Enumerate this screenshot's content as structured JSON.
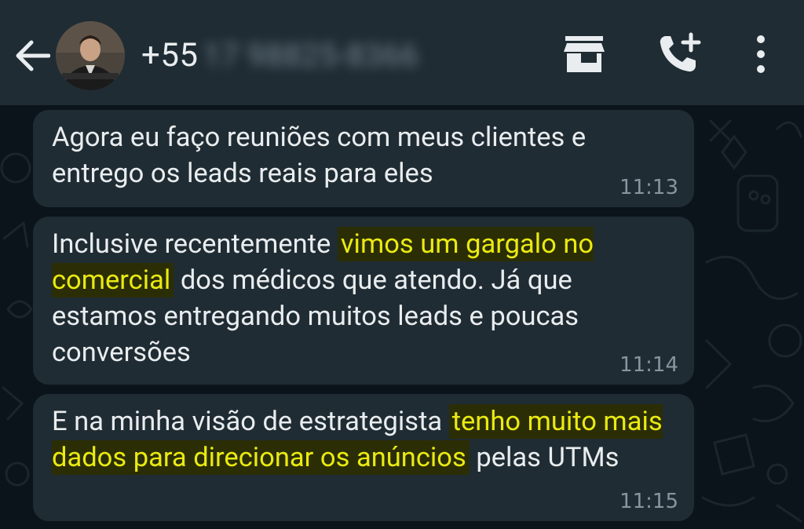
{
  "header": {
    "contact_prefix": "+55",
    "contact_blurred": "17 98825-8366",
    "icons": [
      "back-arrow-icon",
      "avatar",
      "store-icon",
      "call-add-icon",
      "more-vert-icon"
    ]
  },
  "messages": [
    {
      "segments": [
        {
          "text": "Agora eu faço reuniões com meus clientes e entrego os leads reais para eles",
          "highlight": false
        }
      ],
      "time": "11:13"
    },
    {
      "segments": [
        {
          "text": "Inclusive recentemente ",
          "highlight": false
        },
        {
          "text": "vimos um gargalo no comercial",
          "highlight": true
        },
        {
          "text": " dos médicos que atendo. Já que estamos entregando muitos leads e poucas conversões",
          "highlight": false
        }
      ],
      "time": "11:14"
    },
    {
      "segments": [
        {
          "text": "E na minha visão de estrategista ",
          "highlight": false
        },
        {
          "text": "tenho muito mais dados para direcionar os anúncios",
          "highlight": true
        },
        {
          "text": " pelas UTMs",
          "highlight": false
        }
      ],
      "time": "11:15"
    }
  ],
  "colors": {
    "header_bg": "#1f2c34",
    "chat_bg": "#0b141a",
    "bubble_bg": "#202c33",
    "highlight_text": "#eaea12",
    "highlight_bg": "#2b2e05",
    "time_text": "#8696a0"
  }
}
